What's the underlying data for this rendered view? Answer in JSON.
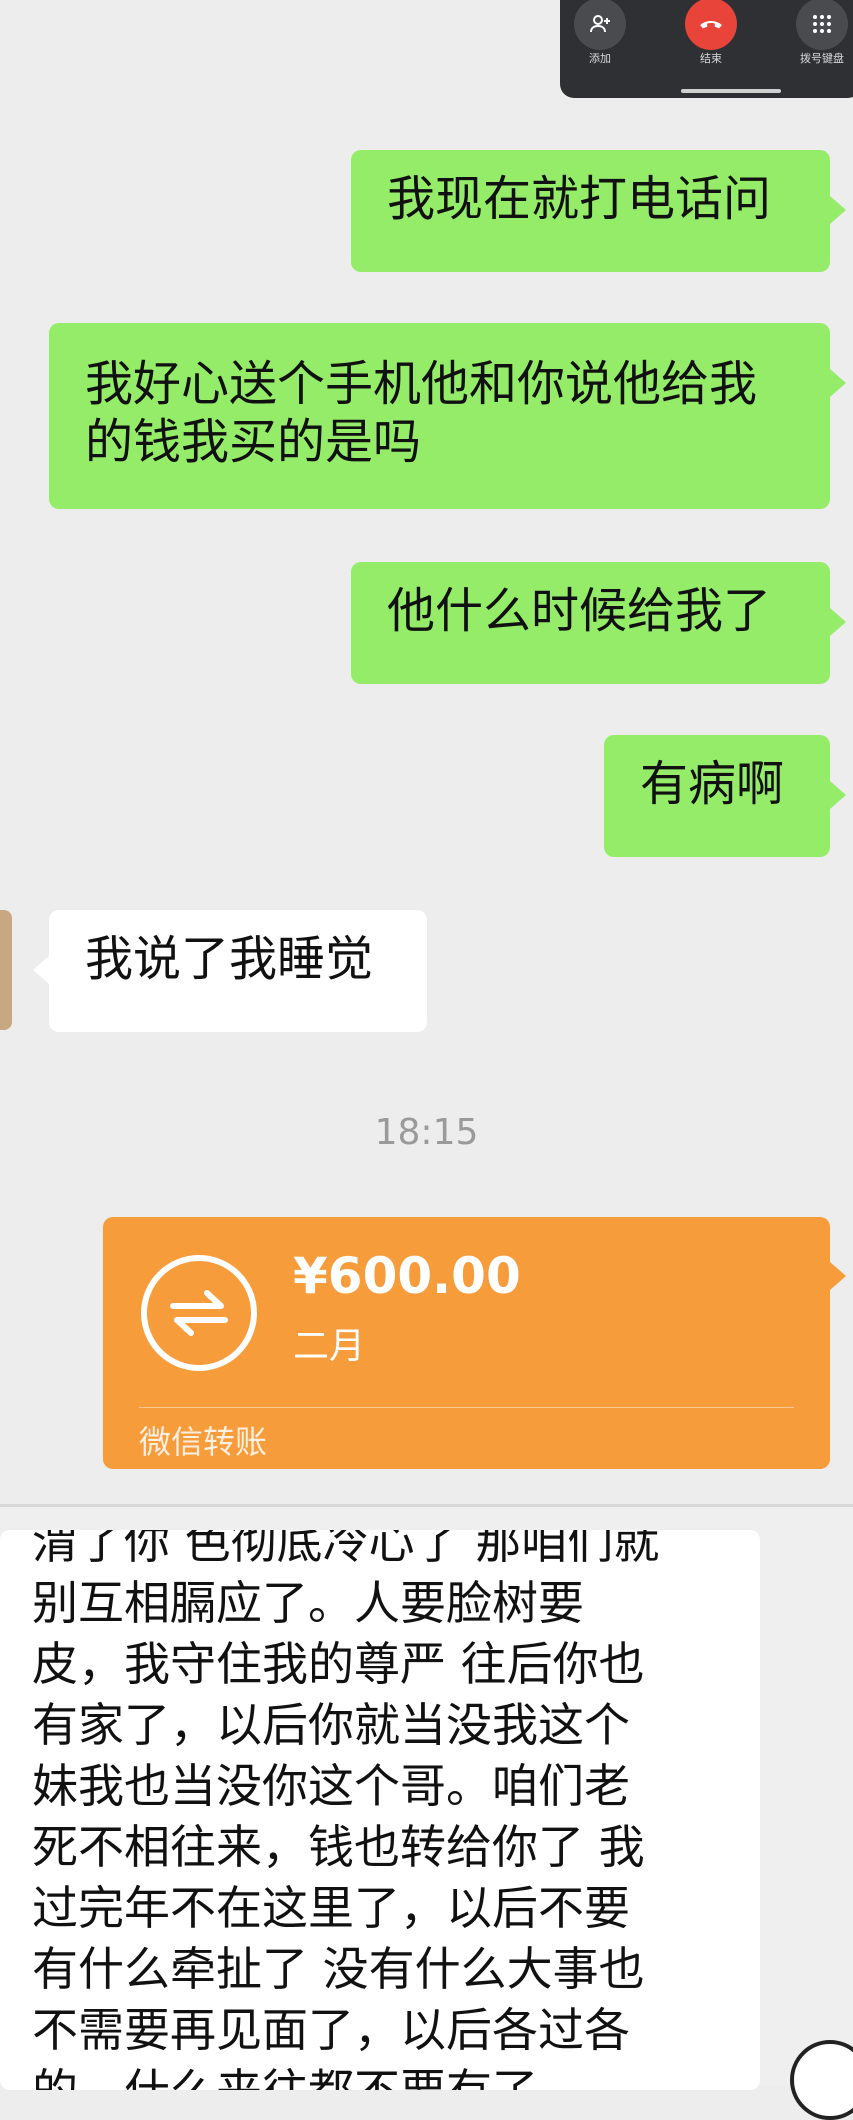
{
  "call_panel": {
    "add_label": "添加",
    "end_label": "结束",
    "keypad_label": "拨号键盘"
  },
  "messages": [
    {
      "side": "right",
      "text": "我现在就打电话问"
    },
    {
      "side": "right",
      "text_lines": [
        "我好心送个手机他和你说他给我",
        "的钱我买的是吗"
      ]
    },
    {
      "side": "right",
      "text": "他什么时候给我了"
    },
    {
      "side": "right",
      "text": "有病啊"
    },
    {
      "side": "left",
      "text": "我说了我睡觉"
    }
  ],
  "timestamp": "18:15",
  "transfer": {
    "amount": "¥600.00",
    "note": "二月",
    "label": "微信转账",
    "icon": "transfer-arrows-icon",
    "color": "#f79c3b"
  },
  "long_message": {
    "lines": [
      "渭了你 色彻底冷心了 那咱们就",
      "别互相膈应了。人要脸树要",
      "皮，我守住我的尊严 往后你也",
      "有家了，以后你就当没我这个",
      "妹我也当没你这个哥。咱们老",
      "死不相往来，钱也转给你了 我",
      "过完年不在这里了，以后不要",
      "有什么牵扯了 没有什么大事也",
      "不需要再见面了，以后各过各",
      "的，什么来往都不要有了"
    ]
  },
  "colors": {
    "background": "#ededed",
    "green_bubble": "#95ec69",
    "white_bubble": "#ffffff",
    "call_panel": "#2f3033",
    "end_call": "#e8443a"
  }
}
